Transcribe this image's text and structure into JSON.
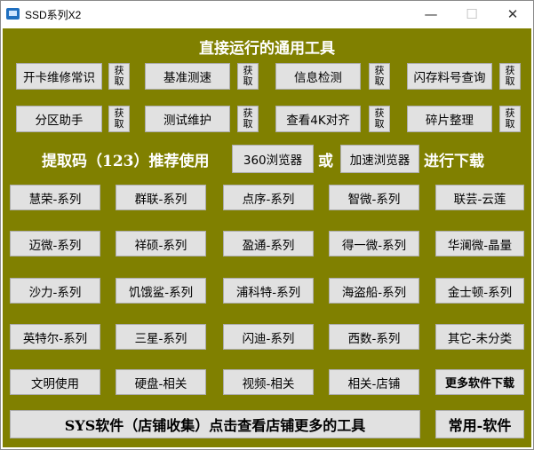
{
  "window": {
    "title": "SSD系列X2",
    "minimize_glyph": "—",
    "maximize_glyph": "☐",
    "close_glyph": "✕"
  },
  "heading": "直接运行的通用工具",
  "tools": [
    {
      "label": "开卡维修常识",
      "get": "获取"
    },
    {
      "label": "基准测速",
      "get": "获取"
    },
    {
      "label": "信息检测",
      "get": "获取"
    },
    {
      "label": "闪存料号查询",
      "get": "获取"
    },
    {
      "label": "分区助手",
      "get": "获取"
    },
    {
      "label": "测试维护",
      "get": "获取"
    },
    {
      "label": "查看4K对齐",
      "get": "获取"
    },
    {
      "label": "碎片整理",
      "get": "获取"
    }
  ],
  "extract": {
    "prefix": "提取码（123）推荐使用",
    "browser1": "360浏览器",
    "or": "或",
    "browser2": "加速浏览器",
    "suffix": "进行下载"
  },
  "series": [
    "慧荣-系列",
    "群联-系列",
    "点序-系列",
    "智微-系列",
    "联芸-云莲",
    "迈微-系列",
    "祥硕-系列",
    "盈通-系列",
    "得一微-系列",
    "华澜微-晶量",
    "沙力-系列",
    "饥饿鲨-系列",
    "浦科特-系列",
    "海盗船-系列",
    "金士顿-系列",
    "英特尔-系列",
    "三星-系列",
    "闪迪-系列",
    "西数-系列",
    "其它-未分类",
    "文明使用",
    "硬盘-相关",
    "视频-相关",
    "相关-店铺",
    "更多软件下载"
  ],
  "bottom": {
    "sys_label": "SYS软件（店铺收集）点击查看店铺更多的工具",
    "common_label": "常用-软件"
  }
}
